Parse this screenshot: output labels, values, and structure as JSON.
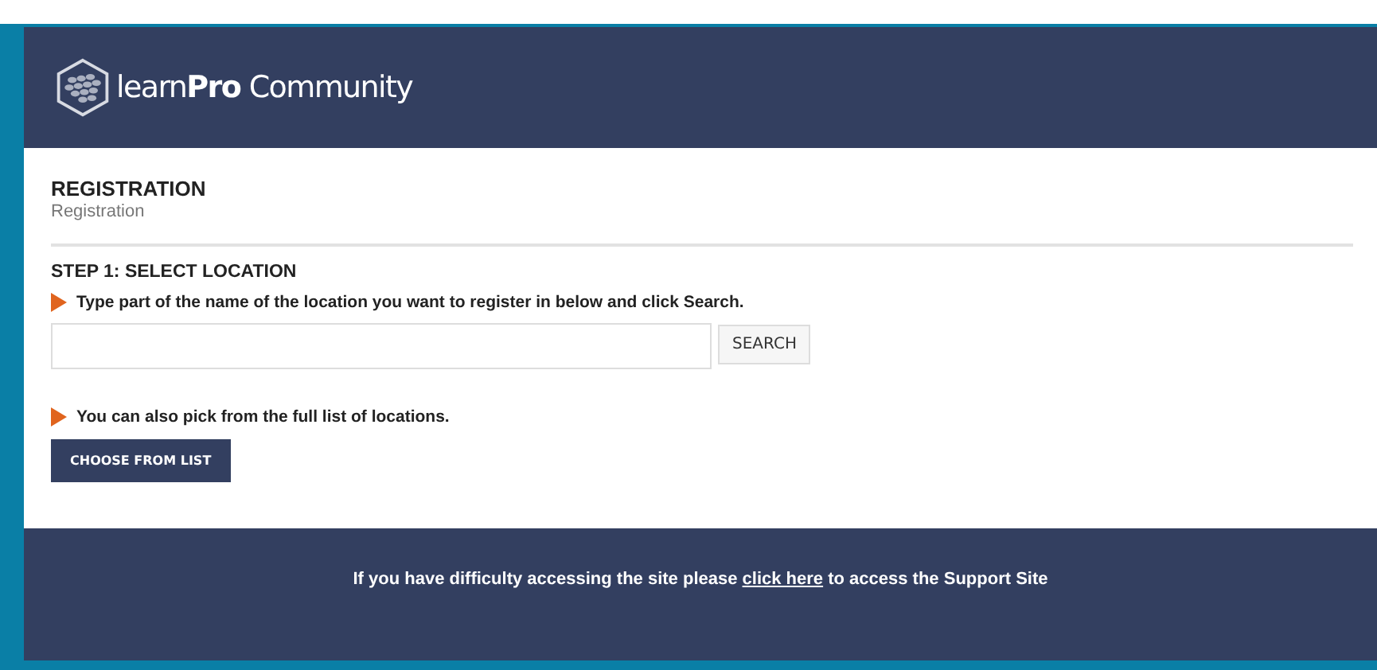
{
  "header": {
    "logo_text": "learn**Pro** Community"
  },
  "page": {
    "title": "REGISTRATION",
    "breadcrumb": "Registration"
  },
  "step": {
    "title": "STEP 1: SELECT LOCATION",
    "instruction_search": "Type part of the name of the location you want to register in below and click Search.",
    "search_button": "SEARCH",
    "instruction_list": "You can also pick from the full list of locations.",
    "list_button": "CHOOSE FROM LIST"
  },
  "footer": {
    "text_before": "If you have difficulty accessing the site please",
    "link": "click here",
    "text_after": "to access the Support Site"
  }
}
